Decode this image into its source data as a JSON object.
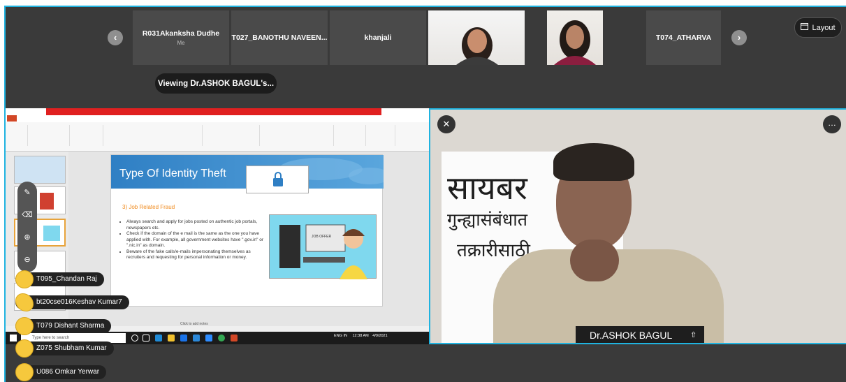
{
  "strip": {
    "prev_icon": "chevron-left-icon",
    "next_icon": "chevron-right-icon",
    "tiles": [
      {
        "name": "R031Akanksha Dudhe",
        "sub": "Me"
      },
      {
        "name": "T027_BANOTHU NAVEEN...",
        "sub": ""
      },
      {
        "name": "khanjali",
        "sub": ""
      },
      {
        "name": "T074_ATHARVA",
        "sub": ""
      }
    ]
  },
  "layout_button": {
    "label": "Layout",
    "icon": "layout-icon"
  },
  "viewing_label": "Viewing Dr.ASHOK BAGUL's...",
  "slide": {
    "title": "Type Of Identity Theft",
    "subtitle": "3) Job Related Fraud",
    "bullets": [
      "Always search and apply for jobs posted on authentic job portals, newspapers etc.",
      "Check if the domain of the e mail is the same as the one you have applied with. For example, all government websites have \".gov.in\" or \".nic.in\" as domain.",
      "Beware of the fake calls/e-mails impersonating themselves as recruiters and requesting for personal information or money."
    ],
    "image_label": "JOB OFFER",
    "notes_placeholder": "Click to add notes"
  },
  "taskbar": {
    "search_placeholder": "Type here to search",
    "lang": "ENG IN",
    "time": "12:38 AM",
    "date": "4/9/2021"
  },
  "reactions": [
    {
      "name": "T095_Chandan Raj"
    },
    {
      "name": "bt20cse016Keshav Kumar7"
    },
    {
      "name": "T079 Dishant Sharma"
    },
    {
      "name": "Z075 Shubham Kumar"
    },
    {
      "name": "U086 Omkar Yerwar"
    }
  ],
  "speaker": {
    "name": "Dr.ASHOK BAGUL",
    "banner_line1": "सायबर",
    "banner_line2": "गुन्ह्यासंबंधात",
    "banner_line3": "तक्रारीसाठी"
  }
}
